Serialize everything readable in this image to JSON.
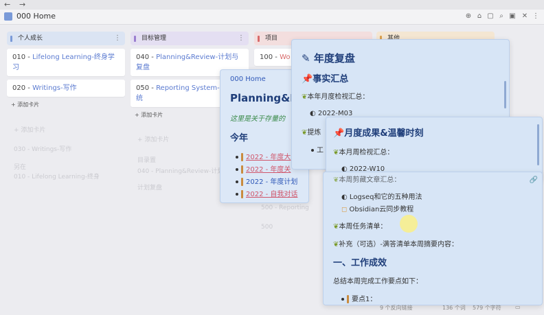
{
  "app": {
    "tab_title": "000 Home",
    "back": "←",
    "forward": "→",
    "toolbar_icons": [
      "⊕",
      "⌂",
      "▢",
      "⌕",
      "▣",
      "✕",
      "⋮"
    ]
  },
  "board": {
    "lanes": [
      {
        "title": "个人成长",
        "bar_color": "#7a9ad8",
        "header_bg": "#dbe4f3",
        "cards": [
          {
            "code": "010 - ",
            "link": "Lifelong Learning-终身学习"
          },
          {
            "code": "020 - ",
            "link": "Writings-写作"
          }
        ],
        "add_card": "+ 添加卡片"
      },
      {
        "title": "目标管理",
        "bar_color": "#9b7fd0",
        "header_bg": "#e4dff2",
        "cards": [
          {
            "code": "040 - ",
            "link": "Planning&Review-计划与复盘"
          },
          {
            "code": "050 - ",
            "link": "Reporting System-报告系统"
          }
        ],
        "add_card": "+ 添加卡片"
      },
      {
        "title": "项目",
        "bar_color": "#d86a6a",
        "header_bg": "#f3dede",
        "cards": [
          {
            "code": "100 - ",
            "link": "Wo"
          }
        ],
        "add_card": ""
      },
      {
        "title": "其他",
        "bar_color": "#d9a050",
        "header_bg": "#f4e6d2",
        "cards": [],
        "add_card": ""
      }
    ],
    "ghost_left": [
      "+ 添加卡片",
      "030 - Writings-写作",
      "另在",
      "010 - Lifelong Learning-终身"
    ],
    "ghost_mid": [
      "+ 添加卡片",
      "目录置",
      "040 - Planning&Review-计划",
      "计划复盘"
    ],
    "ghost_right": [
      "500 - Reporting",
      "500"
    ]
  },
  "popup_planning": {
    "breadcrumb": "000 Home",
    "title": "Planning&R",
    "subtitle": "这里是关于存量的",
    "section": "今年",
    "items": [
      {
        "text": "2022 - 年度大",
        "style": "pink"
      },
      {
        "text": "2022 - 年度关",
        "style": "pink"
      },
      {
        "text": "2022 - 年度计划",
        "style": "blue"
      },
      {
        "text": "2022 - 自我对话",
        "style": "pink"
      }
    ]
  },
  "popup_annual": {
    "title": "年度复盘",
    "section": "事实汇总",
    "monthly_label": "本年月度检视汇总：",
    "monthly_link": "2022-M03",
    "tip_label": "提炼",
    "sub_item": "工"
  },
  "popup_monthly": {
    "title": "月度成果&温馨时刻",
    "weekly_label": "本月周检视汇总：",
    "weekly_link": "2022-W10"
  },
  "popup_weekly": {
    "label_clipped": "本周剪藏文章汇总：",
    "links": [
      {
        "text": "Logseq和它的五种用法",
        "icon": "◐"
      },
      {
        "text": "Obsidian云同步教程",
        "icon": "◻"
      }
    ],
    "task_label": "本周任务清单：",
    "supplement": "补充（可选）-满答清单本周摘要内容：",
    "section": "一、工作成效",
    "summary": "总结本周完成工作要点如下：",
    "point": "要点1："
  },
  "statusbar": {
    "backlinks": "9 个反向链接",
    "words": "136 个词",
    "chars": "579 个字符"
  }
}
